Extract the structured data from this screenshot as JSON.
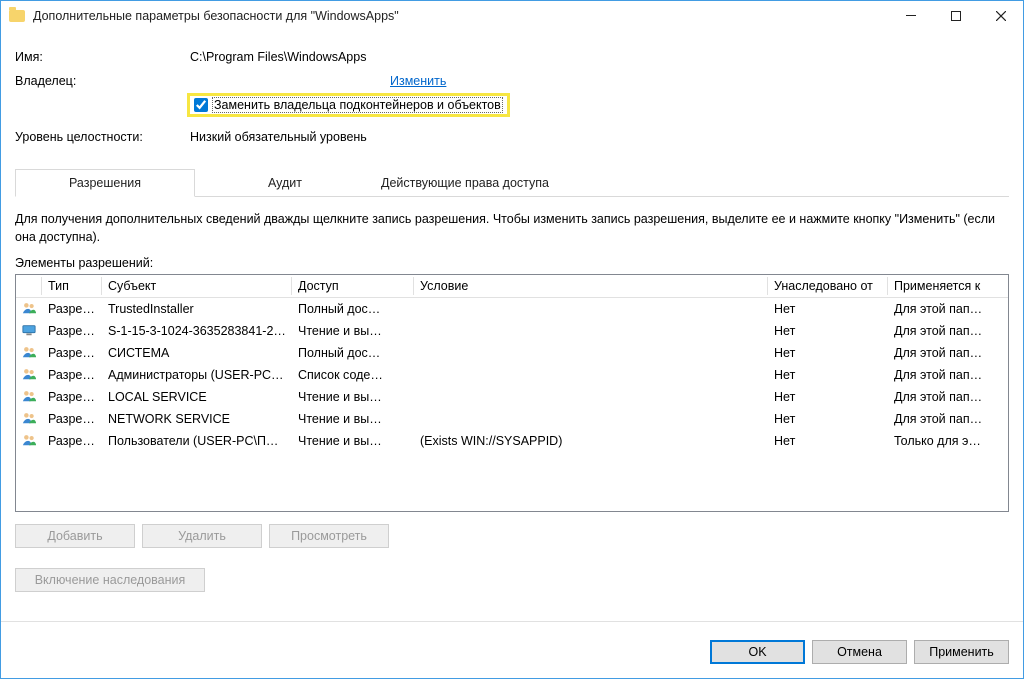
{
  "window": {
    "title": "Дополнительные параметры безопасности  для \"WindowsApps\""
  },
  "props": {
    "name_label": "Имя:",
    "name_value": "C:\\Program Files\\WindowsApps",
    "owner_label": "Владелец:",
    "owner_change": "Изменить",
    "replace_owner_label": "Заменить владельца подконтейнеров и объектов",
    "integrity_label": "Уровень целостности:",
    "integrity_value": "Низкий обязательный уровень"
  },
  "tabs": {
    "perm": "Разрешения",
    "audit": "Аудит",
    "effective": "Действующие права доступа"
  },
  "info": "Для получения дополнительных сведений дважды щелкните запись разрешения. Чтобы изменить запись разрешения, выделите ее и нажмите кнопку \"Изменить\" (если она доступна).",
  "list_label": "Элементы разрешений:",
  "columns": {
    "type": "Тип",
    "subject": "Субъект",
    "access": "Доступ",
    "condition": "Условие",
    "inherited": "Унаследовано от",
    "applies": "Применяется к"
  },
  "rows": [
    {
      "icon": "group",
      "type": "Разре…",
      "subject": "TrustedInstaller",
      "access": "Полный дос…",
      "condition": "",
      "inherited": "Нет",
      "applies": "Для этой пап…"
    },
    {
      "icon": "pc",
      "type": "Разре…",
      "subject": "S-1-15-3-1024-3635283841-2…",
      "access": "Чтение и вы…",
      "condition": "",
      "inherited": "Нет",
      "applies": "Для этой пап…"
    },
    {
      "icon": "group",
      "type": "Разре…",
      "subject": "СИСТЕМА",
      "access": "Полный дос…",
      "condition": "",
      "inherited": "Нет",
      "applies": "Для этой пап…"
    },
    {
      "icon": "group",
      "type": "Разре…",
      "subject": "Администраторы (USER-PC…",
      "access": "Список соде…",
      "condition": "",
      "inherited": "Нет",
      "applies": "Для этой пап…"
    },
    {
      "icon": "group",
      "type": "Разре…",
      "subject": "LOCAL SERVICE",
      "access": "Чтение и вы…",
      "condition": "",
      "inherited": "Нет",
      "applies": "Для этой пап…"
    },
    {
      "icon": "group",
      "type": "Разре…",
      "subject": "NETWORK SERVICE",
      "access": "Чтение и вы…",
      "condition": "",
      "inherited": "Нет",
      "applies": "Для этой пап…"
    },
    {
      "icon": "group",
      "type": "Разре…",
      "subject": "Пользователи (USER-PC\\П…",
      "access": "Чтение и вы…",
      "condition": "(Exists WIN://SYSAPPID)",
      "inherited": "Нет",
      "applies": "Только для э…"
    }
  ],
  "buttons": {
    "add": "Добавить",
    "remove": "Удалить",
    "view": "Просмотреть",
    "enable_inh": "Включение наследования",
    "ok": "OK",
    "cancel": "Отмена",
    "apply": "Применить"
  }
}
